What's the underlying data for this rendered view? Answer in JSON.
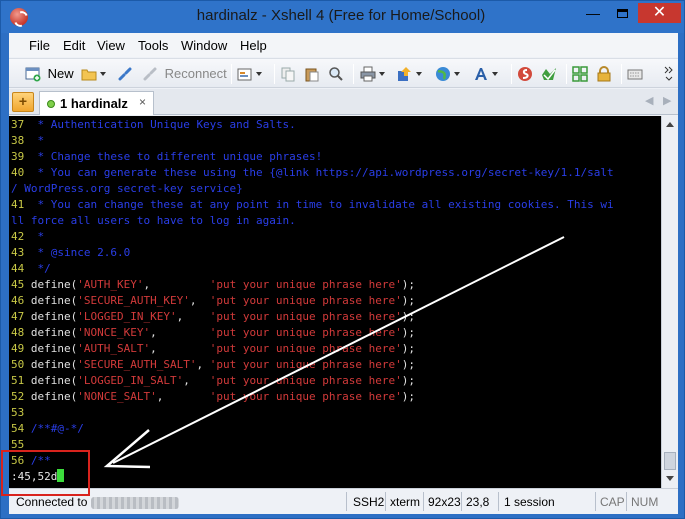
{
  "window": {
    "title": "hardinalz - Xshell 4 (Free for Home/School)",
    "min_glyph": "—",
    "close_glyph": "✕"
  },
  "menu": [
    "File",
    "Edit",
    "View",
    "Tools",
    "Window",
    "Help"
  ],
  "toolbar": {
    "new_label": "New",
    "reconnect_label": "Reconnect"
  },
  "tabs": {
    "add_glyph": "+",
    "active": {
      "label": "1 hardinalz",
      "close_glyph": "×"
    },
    "nav_left": "◀",
    "nav_right": "▶"
  },
  "terminal": {
    "lines": [
      {
        "n": "37",
        "segs": [
          {
            "t": " * Authentication Unique Keys and Salts.",
            "c": "c-comment"
          }
        ]
      },
      {
        "n": "38",
        "segs": [
          {
            "t": " *",
            "c": "c-comment"
          }
        ]
      },
      {
        "n": "39",
        "segs": [
          {
            "t": " * Change these to different unique phrases!",
            "c": "c-comment"
          }
        ]
      },
      {
        "n": "40",
        "segs": [
          {
            "t": " * You can generate these using the {@link https://api.wordpress.org/secret-key/1.1/salt",
            "c": "c-comment"
          }
        ]
      },
      {
        "n": "",
        "segs": [
          {
            "t": "/ WordPress.org secret-key service}",
            "c": "c-comment"
          }
        ]
      },
      {
        "n": "41",
        "segs": [
          {
            "t": " * You can change these at any point in time to invalidate all existing cookies. This wi",
            "c": "c-comment"
          }
        ]
      },
      {
        "n": "",
        "segs": [
          {
            "t": "ll force all users to have to log in again.",
            "c": "c-comment"
          }
        ]
      },
      {
        "n": "42",
        "segs": [
          {
            "t": " *",
            "c": "c-comment"
          }
        ]
      },
      {
        "n": "43",
        "segs": [
          {
            "t": " * @since 2.6.0",
            "c": "c-comment"
          }
        ]
      },
      {
        "n": "44",
        "segs": [
          {
            "t": " */",
            "c": "c-comment"
          }
        ]
      },
      {
        "n": "45",
        "segs": [
          {
            "t": "define(",
            "c": "c-kw"
          },
          {
            "t": "'AUTH_KEY'",
            "c": "c-red"
          },
          {
            "t": ",         ",
            "c": "c-kw"
          },
          {
            "t": "'put your unique phrase here'",
            "c": "c-red"
          },
          {
            "t": ");",
            "c": "c-kw"
          }
        ]
      },
      {
        "n": "46",
        "segs": [
          {
            "t": "define(",
            "c": "c-kw"
          },
          {
            "t": "'SECURE_AUTH_KEY'",
            "c": "c-red"
          },
          {
            "t": ",  ",
            "c": "c-kw"
          },
          {
            "t": "'put your unique phrase here'",
            "c": "c-red"
          },
          {
            "t": ");",
            "c": "c-kw"
          }
        ]
      },
      {
        "n": "47",
        "segs": [
          {
            "t": "define(",
            "c": "c-kw"
          },
          {
            "t": "'LOGGED_IN_KEY'",
            "c": "c-red"
          },
          {
            "t": ",    ",
            "c": "c-kw"
          },
          {
            "t": "'put your unique phrase here'",
            "c": "c-red"
          },
          {
            "t": ");",
            "c": "c-kw"
          }
        ]
      },
      {
        "n": "48",
        "segs": [
          {
            "t": "define(",
            "c": "c-kw"
          },
          {
            "t": "'NONCE_KEY'",
            "c": "c-red"
          },
          {
            "t": ",        ",
            "c": "c-kw"
          },
          {
            "t": "'put your unique phrase here'",
            "c": "c-red"
          },
          {
            "t": ");",
            "c": "c-kw"
          }
        ]
      },
      {
        "n": "49",
        "segs": [
          {
            "t": "define(",
            "c": "c-kw"
          },
          {
            "t": "'AUTH_SALT'",
            "c": "c-red"
          },
          {
            "t": ",        ",
            "c": "c-kw"
          },
          {
            "t": "'put your unique phrase here'",
            "c": "c-red"
          },
          {
            "t": ");",
            "c": "c-kw"
          }
        ]
      },
      {
        "n": "50",
        "segs": [
          {
            "t": "define(",
            "c": "c-kw"
          },
          {
            "t": "'SECURE_AUTH_SALT'",
            "c": "c-red"
          },
          {
            "t": ", ",
            "c": "c-kw"
          },
          {
            "t": "'put your unique phrase here'",
            "c": "c-red"
          },
          {
            "t": ");",
            "c": "c-kw"
          }
        ]
      },
      {
        "n": "51",
        "segs": [
          {
            "t": "define(",
            "c": "c-kw"
          },
          {
            "t": "'LOGGED_IN_SALT'",
            "c": "c-red"
          },
          {
            "t": ",   ",
            "c": "c-kw"
          },
          {
            "t": "'put your unique phrase here'",
            "c": "c-red"
          },
          {
            "t": ");",
            "c": "c-kw"
          }
        ]
      },
      {
        "n": "52",
        "segs": [
          {
            "t": "define(",
            "c": "c-kw"
          },
          {
            "t": "'NONCE_SALT'",
            "c": "c-red"
          },
          {
            "t": ",       ",
            "c": "c-kw"
          },
          {
            "t": "'put your unique phrase here'",
            "c": "c-red"
          },
          {
            "t": ");",
            "c": "c-kw"
          }
        ]
      },
      {
        "n": "53",
        "segs": []
      },
      {
        "n": "54",
        "segs": [
          {
            "t": "/**#@-*/",
            "c": "c-comment"
          }
        ]
      },
      {
        "n": "55",
        "segs": []
      },
      {
        "n": "56",
        "segs": [
          {
            "t": "/**",
            "c": "c-comment"
          }
        ]
      }
    ],
    "command": ":45,52d"
  },
  "status": {
    "connected": "Connected to",
    "protocol": "SSH2",
    "term": "xterm",
    "size": "92x23",
    "cursor": "23,8",
    "sessions": "1 session",
    "caps": "CAP",
    "num": "NUM"
  },
  "colors": {
    "titlebar": "#2f73c9",
    "terminal_bg": "#000000",
    "comment": "#2a3ee8",
    "string": "#d23a3a",
    "line_number": "#c8c846",
    "cursor": "#3cdc3c",
    "highlight_box": "#d9231d"
  }
}
